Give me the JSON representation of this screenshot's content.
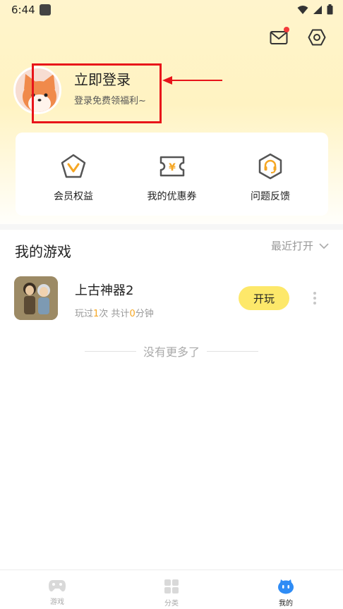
{
  "status_bar": {
    "time": "6:44"
  },
  "header": {
    "mail_icon": "mail-icon",
    "settings_icon": "settings-icon",
    "mail_has_unread": true
  },
  "profile": {
    "login_title": "立即登录",
    "login_subtitle": "登录免费领福利~"
  },
  "features": [
    {
      "label": "会员权益",
      "icon": "vip-badge-icon"
    },
    {
      "label": "我的优惠券",
      "icon": "coupon-icon"
    },
    {
      "label": "问题反馈",
      "icon": "headset-icon"
    }
  ],
  "my_games": {
    "title": "我的游戏",
    "sort_label": "最近打开",
    "games": [
      {
        "name": "上古神器2",
        "stats_prefix": "玩过",
        "play_count": "1",
        "stats_mid": "次 共计",
        "play_minutes": "0",
        "stats_suffix": "分钟",
        "play_label": "开玩"
      }
    ],
    "no_more": "没有更多了"
  },
  "bottom_nav": [
    {
      "label": "游戏",
      "icon": "gamepad-icon",
      "active": false
    },
    {
      "label": "分类",
      "icon": "category-grid-icon",
      "active": false
    },
    {
      "label": "我的",
      "icon": "profile-mascot-icon",
      "active": true
    }
  ],
  "colors": {
    "accent_yellow": "#fde86a",
    "highlight_orange": "#f5a623",
    "annotation_red": "#e8141a",
    "icon_orange": "#f5a623"
  }
}
